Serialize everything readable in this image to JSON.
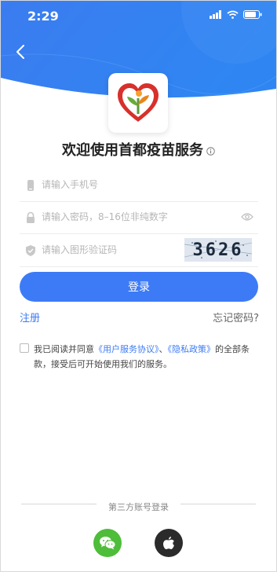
{
  "status_bar": {
    "time": "2:29"
  },
  "header": {
    "title": "欢迎使用首都疫苗服务"
  },
  "fields": {
    "phone_placeholder": "请输入手机号",
    "password_placeholder": "请输入密码，8–16位非纯数字",
    "captcha_placeholder": "请输入图形验证码",
    "captcha_value": "3626"
  },
  "actions": {
    "login_label": "登录",
    "register_label": "注册",
    "forgot_label": "忘记密码?"
  },
  "agreement": {
    "prefix": "我已阅读并同意",
    "user_agreement": "《用户服务协议》",
    "separator": "、",
    "privacy_policy": "《隐私政策》",
    "suffix": "的全部条款，接受后可开始使用我们的服务。"
  },
  "third_party": {
    "label": "第三方账号登录",
    "providers": [
      "wechat-icon",
      "apple-icon"
    ]
  },
  "colors": {
    "primary": "#3d7bf6",
    "wechat": "#4ebd3a",
    "apple": "#2b2b2b"
  }
}
